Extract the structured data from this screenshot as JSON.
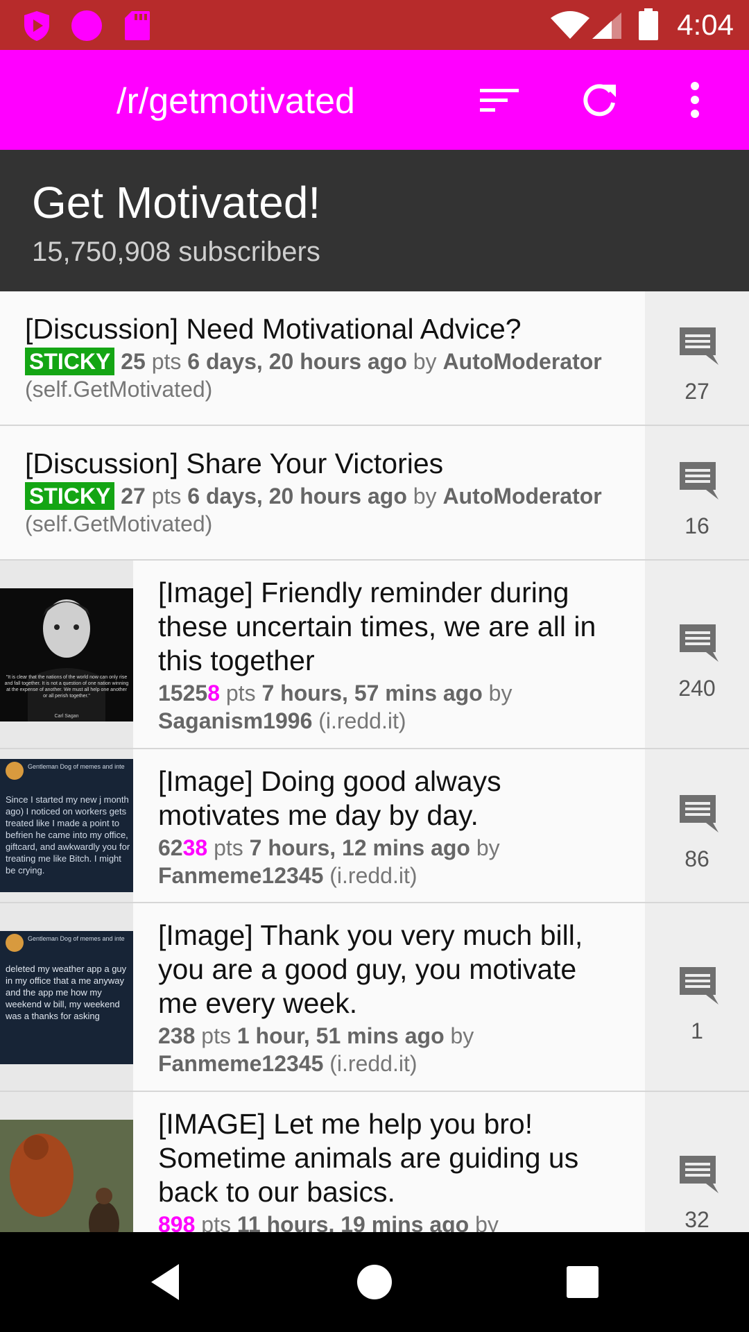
{
  "status_bar": {
    "time": "4:04"
  },
  "app_bar": {
    "title": "/r/getmotivated",
    "colors": {
      "app_bar": "#ff00ff",
      "status_bar": "#b72b2b"
    }
  },
  "subreddit": {
    "name": "Get Motivated!",
    "subscribers": "15,750,908 subscribers"
  },
  "posts": [
    {
      "title": "[Discussion] Need Motivational Advice?",
      "sticky": "STICKY",
      "points": "25",
      "pts_label": "pts",
      "age": "6 days, 20 hours ago",
      "by_label": "by",
      "author": "AutoModerator",
      "domain": "(self.GetMotivated)",
      "comments": "27"
    },
    {
      "title": "[Discussion] Share Your Victories",
      "sticky": "STICKY",
      "points": "27",
      "pts_label": "pts",
      "age": "6 days, 20 hours ago",
      "by_label": "by",
      "author": "AutoModerator",
      "domain": "(self.GetMotivated)",
      "comments": "16"
    },
    {
      "title": "[Image] Friendly reminder during these uncertain times, we are all in this together",
      "points": "1525",
      "points_changed": "8",
      "pts_label": "pts",
      "age": "7 hours, 57 mins ago",
      "by_label": "by",
      "author": "Saganism1996",
      "domain": "(i.redd.it)",
      "comments": "240",
      "thumb_caption": "\"It is clear that the nations of the world now can only rise and fall together. It is not a question of one nation winning at the expense of another. We must all help one another or all perish together.\"",
      "thumb_credit": "Carl Sagan"
    },
    {
      "title": "[Image] Doing good always motivates me day by day.",
      "points": "62",
      "points_changed": "38",
      "pts_label": "pts",
      "age": "7 hours, 12 mins ago",
      "by_label": "by",
      "author": "Fanmeme12345",
      "domain": "(i.redd.it)",
      "comments": "86",
      "thumb_caption": "Since I started my new j month ago) I noticed on workers gets treated like I made a point to befrien he came into my office, giftcard, and awkwardly you for treating me like Bitch. I might be crying.",
      "thumb_credit": "Gentleman Dog of memes and inte"
    },
    {
      "title": "[Image] Thank you very much bill, you are a good guy, you motivate me every week.",
      "points": "238",
      "pts_label": "pts",
      "age": "1 hour, 51 mins ago",
      "by_label": "by",
      "author": "Fanmeme12345",
      "domain": "(i.redd.it)",
      "comments": "1",
      "thumb_caption": "deleted my weather app a guy in my office that a me anyway and the app me how my weekend w bill, my weekend was a thanks for asking",
      "thumb_credit": "Gentleman Dog of memes and inte"
    },
    {
      "title": "[IMAGE] Let me help you bro! Sometime animals are guiding us back to our basics.",
      "points": "898",
      "pts_label": "pts",
      "age": "11 hours, 19 mins ago",
      "by_label": "by",
      "comments": "32"
    }
  ]
}
